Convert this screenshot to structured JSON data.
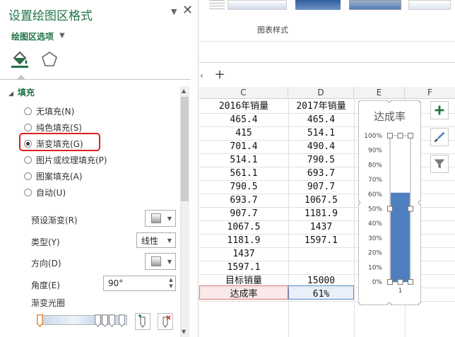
{
  "pane": {
    "title": "设置绘图区格式",
    "menu_arrow": "▼",
    "close": "✕",
    "subtitle": "绘图区选项",
    "section": "填充",
    "fill_options": [
      {
        "label": "无填充(N)",
        "checked": false
      },
      {
        "label": "纯色填充(S)",
        "checked": false
      },
      {
        "label": "渐变填充(G)",
        "checked": true
      },
      {
        "label": "图片或纹理填充(P)",
        "checked": false
      },
      {
        "label": "图案填充(A)",
        "checked": false
      },
      {
        "label": "自动(U)",
        "checked": false
      }
    ],
    "preset_label": "预设渐变(R)",
    "type_label": "类型(Y)",
    "type_value": "线性",
    "direction_label": "方向(D)",
    "angle_label": "角度(E)",
    "angle_value": "90°",
    "stops_label": "渐变光圈"
  },
  "ribbon": {
    "group_label": "图表样式"
  },
  "sheet": {
    "add_sheet": "+",
    "columns": [
      "C",
      "D",
      "E",
      "F"
    ],
    "rows": [
      [
        "2016年销量",
        "2017年销量"
      ],
      [
        "465.4",
        "465.4"
      ],
      [
        "415",
        "514.1"
      ],
      [
        "701.4",
        "490.4"
      ],
      [
        "514.1",
        "790.5"
      ],
      [
        "561.1",
        "693.7"
      ],
      [
        "790.5",
        "907.7"
      ],
      [
        "693.7",
        "1067.5"
      ],
      [
        "907.7",
        "1181.9"
      ],
      [
        "1067.5",
        "1437"
      ],
      [
        "1181.9",
        "1597.1"
      ],
      [
        "1437",
        ""
      ],
      [
        "1597.1",
        ""
      ],
      [
        "目标销量",
        "15000"
      ],
      [
        "达成率",
        "61%"
      ]
    ]
  },
  "chart_data": {
    "type": "bar",
    "title": "达成率",
    "categories": [
      "1"
    ],
    "values": [
      0.61
    ],
    "ylim": [
      0,
      1
    ],
    "yticks": [
      "0%",
      "10%",
      "20%",
      "30%",
      "40%",
      "50%",
      "60%",
      "70%",
      "80%",
      "90%",
      "100%"
    ],
    "bar_color": "#4f7fbf",
    "legend": "none"
  },
  "colors": {
    "accent": "#217346",
    "highlight": "#e02020"
  }
}
